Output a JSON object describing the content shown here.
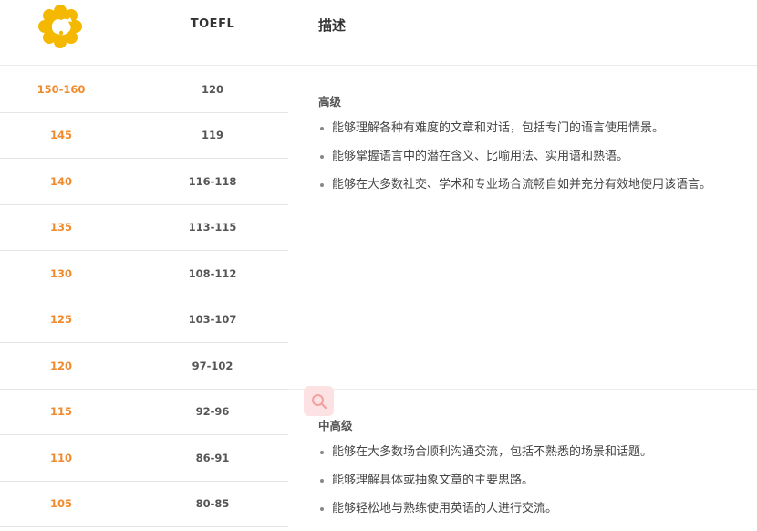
{
  "header": {
    "logo_icon": "orange-flower-logo",
    "col_toefl": "TOEFL",
    "col_desc": "描述"
  },
  "rows": [
    {
      "score": "150-160",
      "toefl": "120"
    },
    {
      "score": "145",
      "toefl": "119"
    },
    {
      "score": "140",
      "toefl": "116-118"
    },
    {
      "score": "135",
      "toefl": "113-115"
    },
    {
      "score": "130",
      "toefl": "108-112"
    },
    {
      "score": "125",
      "toefl": "103-107"
    },
    {
      "score": "120",
      "toefl": "97-102"
    },
    {
      "score": "115",
      "toefl": "92-96"
    },
    {
      "score": "110",
      "toefl": "86-91"
    },
    {
      "score": "105",
      "toefl": "80-85"
    }
  ],
  "levels": [
    {
      "title": "高级",
      "items": [
        "能够理解各种有难度的文章和对话，包括专门的语言使用情景。",
        "能够掌握语言中的潜在含义、比喻用法、实用语和熟语。",
        "能够在大多数社交、学术和专业场合流畅自如并充分有效地使用该语言。"
      ]
    },
    {
      "title": "中高级",
      "items": [
        "能够在大多数场合顺利沟通交流，包括不熟悉的场景和话题。",
        "能够理解具体或抽象文章的主要思路。",
        "能够轻松地与熟练使用英语的人进行交流。"
      ]
    }
  ],
  "colors": {
    "accent_orange": "#f08a2c",
    "logo_yellow": "#f5b800",
    "search_bg": "#fce2e2",
    "search_icon": "#f3a1a1"
  },
  "search_icon": "search-icon"
}
